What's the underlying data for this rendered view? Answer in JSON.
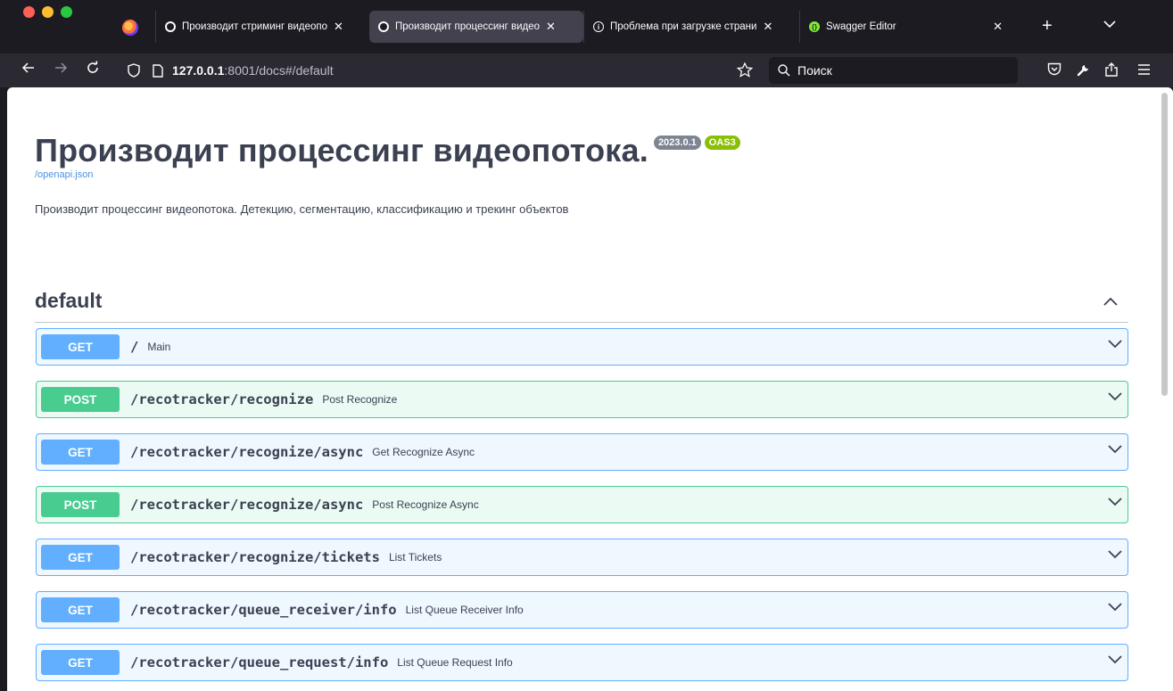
{
  "browser": {
    "tabs": [
      {
        "label": "Производит стриминг видеопо",
        "favicon": "dark-circle-icon",
        "active": false
      },
      {
        "label": "Производит процессинг видео",
        "favicon": "dark-circle-icon",
        "active": true
      },
      {
        "label": "Проблема при загрузке страни",
        "favicon": "info-icon",
        "active": false
      },
      {
        "label": "Swagger Editor",
        "favicon": "swagger-icon",
        "active": false
      }
    ],
    "close_glyph": "✕",
    "new_tab_glyph": "+",
    "list_tabs_glyph": "⌄",
    "url": {
      "host": "127.0.0.1",
      "rest": ":8001/docs#/default"
    },
    "search_placeholder": "Поиск"
  },
  "info": {
    "title": "Производит процессинг видеопотока.",
    "version": "2023.0.1",
    "oas_badge": "OAS3",
    "openapi_link": "/openapi.json",
    "description": "Производит процессинг видеопотока. Детекцию, сегментацию, классификацию и трекинг объектов"
  },
  "section": {
    "title": "default"
  },
  "operations": [
    {
      "method": "GET",
      "path": "/",
      "summary": "Main"
    },
    {
      "method": "POST",
      "path": "/recotracker/recognize",
      "summary": "Post Recognize"
    },
    {
      "method": "GET",
      "path": "/recotracker/recognize/async",
      "summary": "Get Recognize Async"
    },
    {
      "method": "POST",
      "path": "/recotracker/recognize/async",
      "summary": "Post Recognize Async"
    },
    {
      "method": "GET",
      "path": "/recotracker/recognize/tickets",
      "summary": "List Tickets"
    },
    {
      "method": "GET",
      "path": "/recotracker/queue_receiver/info",
      "summary": "List Queue Receiver Info"
    },
    {
      "method": "GET",
      "path": "/recotracker/queue_request/info",
      "summary": "List Queue Request Info"
    }
  ],
  "colors": {
    "get": "#61affe",
    "post": "#49cc90",
    "text": "#3b4151",
    "link": "#4990e2"
  }
}
